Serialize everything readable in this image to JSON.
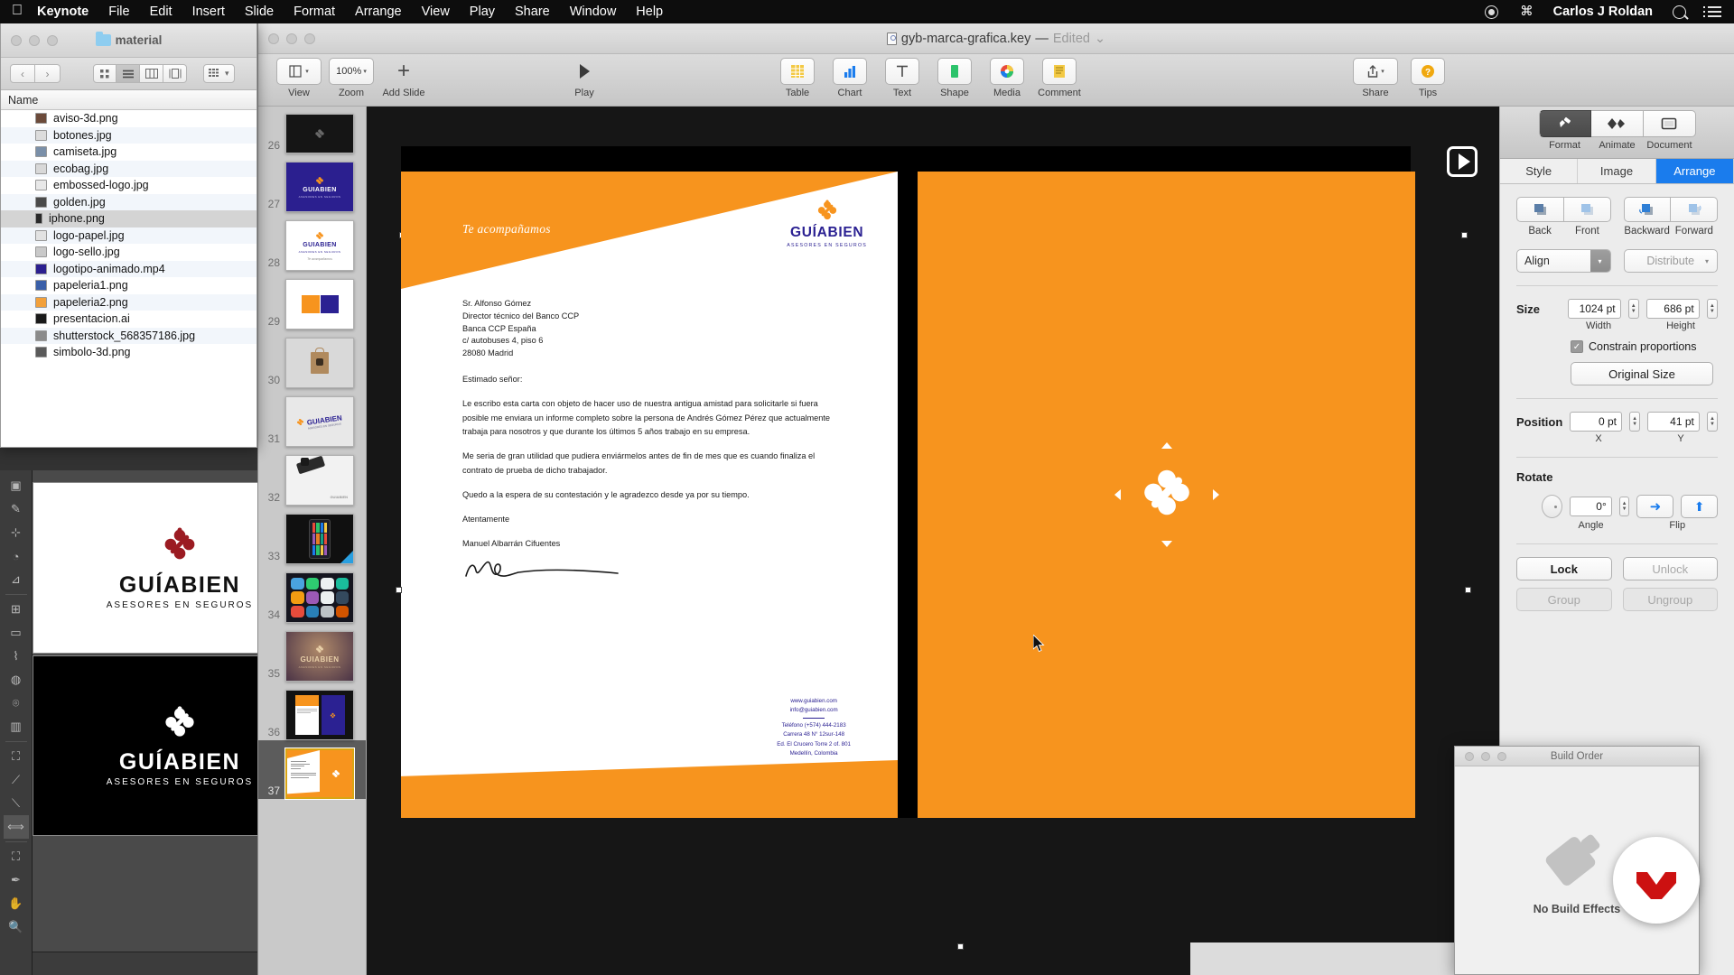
{
  "menubar": {
    "apple_icon": "apple-icon",
    "items": [
      "Keynote",
      "File",
      "Edit",
      "Insert",
      "Slide",
      "Format",
      "Arrange",
      "View",
      "Play",
      "Share",
      "Window",
      "Help"
    ],
    "app_name": "Keynote",
    "right": {
      "record_icon": "record-icon",
      "command_icon": "⌘",
      "user": "Carlos J Roldan",
      "search_icon": "search-icon",
      "notification_icon": "notification-list-icon"
    }
  },
  "finder": {
    "window_title": "material",
    "folder_icon": "folder-icon",
    "back_label": "‹",
    "forward_label": "›",
    "view_modes": [
      "icon-view",
      "list-view",
      "column-view",
      "gallery-view"
    ],
    "active_view": "list-view",
    "arrange_label": "arrange-icon",
    "column_header": "Name",
    "files": [
      {
        "name": "aviso-3d.png",
        "icon_color": "#6b4a3a"
      },
      {
        "name": "botones.jpg",
        "icon_color": "#dcdcdc"
      },
      {
        "name": "camiseta.jpg",
        "icon_color": "#7a8fa8"
      },
      {
        "name": "ecobag.jpg",
        "icon_color": "#d8d8d8"
      },
      {
        "name": "embossed-logo.jpg",
        "icon_color": "#e8e8e8"
      },
      {
        "name": "golden.jpg",
        "icon_color": "#4a4a4a"
      },
      {
        "name": "iphone.png",
        "icon_color": "#2a2a2a",
        "selected": true
      },
      {
        "name": "logo-papel.jpg",
        "icon_color": "#e2e2e2"
      },
      {
        "name": "logo-sello.jpg",
        "icon_color": "#c9c9c9"
      },
      {
        "name": "logotipo-animado.mp4",
        "icon_color": "#2b1f8f"
      },
      {
        "name": "papeleria1.png",
        "icon_color": "#3a5fa8"
      },
      {
        "name": "papeleria2.png",
        "icon_color": "#f2a03a"
      },
      {
        "name": "presentacion.ai",
        "icon_color": "#1a1a1a"
      },
      {
        "name": "shutterstock_568357186.jpg",
        "icon_color": "#8a8a8a"
      },
      {
        "name": "simbolo-3d.png",
        "icon_color": "#5a5a5a"
      }
    ]
  },
  "keynote": {
    "document_title": "gyb-marca-grafica.key",
    "title_separator": "—",
    "edited_label": "Edited",
    "chevron": "⌄",
    "toolbar": [
      {
        "label": "View",
        "icon": "view-icon",
        "has_chevron": true
      },
      {
        "label": "Zoom",
        "icon": "zoom-level",
        "value": "100%",
        "has_chevron": true
      },
      {
        "label": "Add Slide",
        "icon": "plus-icon"
      },
      {
        "label": "Play",
        "icon": "play-icon"
      },
      {
        "label": "Table",
        "icon": "table-icon"
      },
      {
        "label": "Chart",
        "icon": "chart-icon"
      },
      {
        "label": "Text",
        "icon": "text-icon"
      },
      {
        "label": "Shape",
        "icon": "shape-icon"
      },
      {
        "label": "Media",
        "icon": "media-icon"
      },
      {
        "label": "Comment",
        "icon": "comment-icon"
      },
      {
        "label": "Share",
        "icon": "share-icon",
        "has_chevron": true
      },
      {
        "label": "Tips",
        "icon": "tips-icon"
      }
    ],
    "navigator": {
      "slides": [
        {
          "number": "26",
          "kind": "dark-symbol"
        },
        {
          "number": "27",
          "kind": "purple-logo"
        },
        {
          "number": "28",
          "kind": "white-logo"
        },
        {
          "number": "29",
          "kind": "color-swatches"
        },
        {
          "number": "30",
          "kind": "ecobag"
        },
        {
          "number": "31",
          "kind": "paper-logo"
        },
        {
          "number": "32",
          "kind": "stamp"
        },
        {
          "number": "33",
          "kind": "iphone-dark"
        },
        {
          "number": "34",
          "kind": "iphone-apps"
        },
        {
          "number": "35",
          "kind": "golden"
        },
        {
          "number": "36",
          "kind": "papeleria"
        },
        {
          "number": "37",
          "kind": "letter-orange",
          "selected": true
        }
      ]
    },
    "canvas": {
      "play_badge_icon": "play-slide-icon",
      "cursor_icon": "pointer-cursor"
    }
  },
  "letter": {
    "slogan": "Te acompañamos",
    "brand_name": "GUÍABIEN",
    "brand_tagline": "ASESORES EN SEGUROS",
    "address_lines": [
      "Sr. Alfonso Gómez",
      "Director técnico del Banco CCP",
      "Banca CCP España",
      "c/ autobuses 4, piso 6",
      "28080 Madrid"
    ],
    "salutation": "Estimado señor:",
    "paragraph1": "Le escribo esta carta con objeto de hacer uso de nuestra antigua amistad para solicitarle si fuera posible me enviara un informe completo sobre la persona de Andrés Gómez Pérez que actualmente trabaja para nosotros y que durante los últimos 5 años trabajo en su empresa.",
    "paragraph2": "Me seria de gran utilidad que pudiera enviármelos antes de fin de mes que es cuando finaliza el contrato de prueba de dicho trabajador.",
    "paragraph3": "Quedo a la espera de su contestación y le agradezco desde ya por su tiempo.",
    "closing": "Atentamente",
    "signer": "Manuel Albarrán Cifuentes",
    "footer": {
      "website": "www.guiabien.com",
      "email": "info@guiabien.com",
      "phone": "Teléfono (+574) 444-2183",
      "address1": "Carrera 48 N° 12sur-148",
      "address2": "Ed. El Crucero Torre 2 of. 801",
      "address3": "Medellín, Colombia"
    }
  },
  "inspector": {
    "mode_tabs": [
      {
        "label": "Format",
        "icon": "format-brush-icon",
        "active": true
      },
      {
        "label": "Animate",
        "icon": "animate-diamond-icon",
        "active": false
      },
      {
        "label": "Document",
        "icon": "document-icon",
        "active": false
      }
    ],
    "tabs": [
      {
        "label": "Style",
        "active": false
      },
      {
        "label": "Image",
        "active": false
      },
      {
        "label": "Arrange",
        "active": true
      }
    ],
    "arrange": {
      "order_buttons": [
        "Back",
        "Front",
        "Backward",
        "Forward"
      ],
      "align_label": "Align",
      "distribute_label": "Distribute",
      "size_caption": "Size",
      "width_value": "1024 pt",
      "width_label": "Width",
      "height_value": "686 pt",
      "height_label": "Height",
      "constrain_label": "Constrain proportions",
      "constrain_checked": "✓",
      "original_size_label": "Original Size",
      "position_caption": "Position",
      "x_value": "0 pt",
      "x_label": "X",
      "y_value": "41 pt",
      "y_label": "Y",
      "rotate_caption": "Rotate",
      "angle_value": "0°",
      "angle_label": "Angle",
      "flip_label": "Flip",
      "flip_h_icon": "flip-horizontal-icon",
      "flip_v_icon": "flip-vertical-icon",
      "lock_label": "Lock",
      "unlock_label": "Unlock",
      "group_label": "Group",
      "ungroup_label": "Ungroup"
    }
  },
  "build_order": {
    "title": "Build Order",
    "empty_message": "No Build Effects"
  },
  "colors": {
    "brand_orange": "#f7941e",
    "brand_purple": "#2b2192",
    "accent_blue": "#1a7ced",
    "selection_gold": "#d9a514",
    "red_badge": "#cc1111"
  }
}
